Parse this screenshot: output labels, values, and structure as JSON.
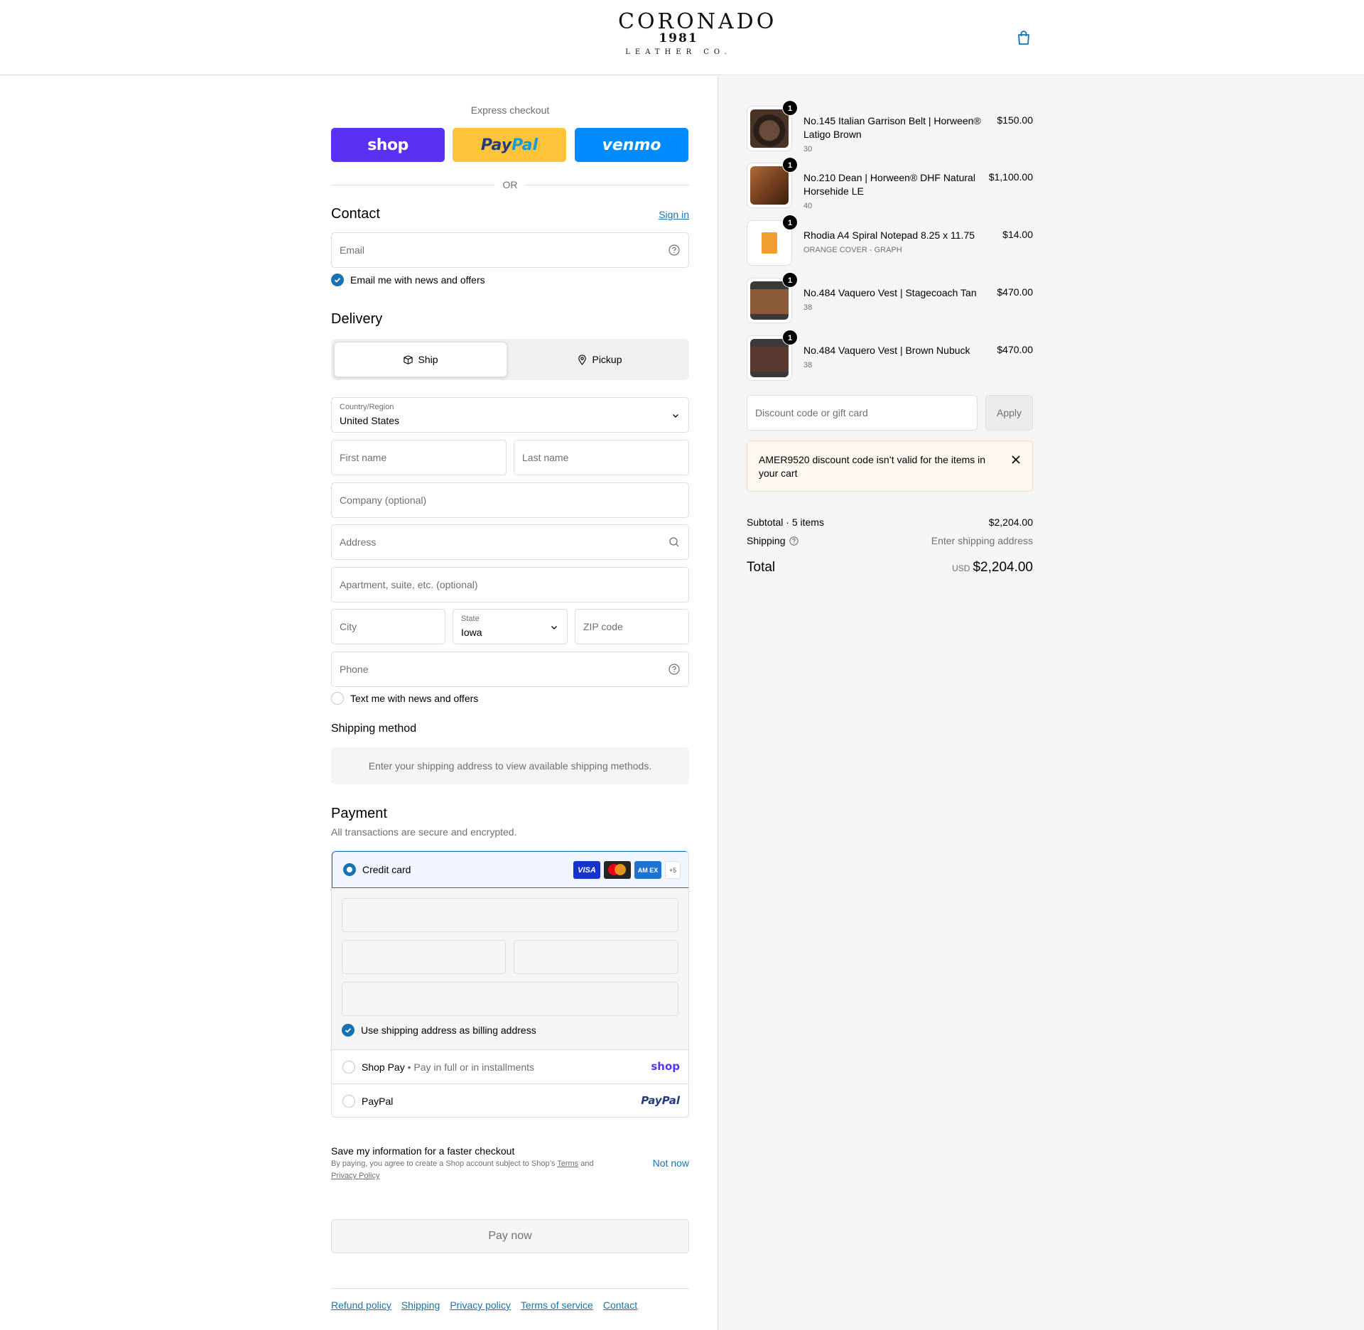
{
  "header": {
    "logo": {
      "word": "CORONADO",
      "year": "1981",
      "sub": "LEATHER CO."
    }
  },
  "express": {
    "title": "Express checkout",
    "shop_label": "shop",
    "paypal_label_1": "Pay",
    "paypal_label_2": "Pal",
    "venmo_label": "venmo",
    "or_label": "OR"
  },
  "contact": {
    "title": "Contact",
    "sign_in": "Sign in",
    "email_placeholder": "Email",
    "news_label": "Email me with news and offers"
  },
  "delivery": {
    "title": "Delivery",
    "ship_label": "Ship",
    "pickup_label": "Pickup",
    "country_label": "Country/Region",
    "country_value": "United States",
    "first_name": "First name",
    "last_name": "Last name",
    "company": "Company (optional)",
    "address": "Address",
    "apartment": "Apartment, suite, etc. (optional)",
    "city": "City",
    "state_label": "State",
    "state_value": "Iowa",
    "zip": "ZIP code",
    "phone": "Phone",
    "text_news": "Text me with news and offers"
  },
  "shipping_method": {
    "title": "Shipping method",
    "note": "Enter your shipping address to view available shipping methods."
  },
  "payment": {
    "title": "Payment",
    "subtitle": "All transactions are secure and encrypted.",
    "credit_card": "Credit card",
    "cards": {
      "visa": "VISA",
      "amex": "AM EX",
      "more": "+5"
    },
    "billing_same": "Use shipping address as billing address",
    "shop_pay": "Shop Pay",
    "shop_pay_sub": " • Pay in full or in installments",
    "shop_pay_brand": "shop",
    "paypal": "PayPal",
    "paypal_brand": "PayPal"
  },
  "save": {
    "title": "Save my information for a faster checkout",
    "text_1": "By paying, you agree to create a Shop account subject to Shop’s ",
    "terms": "Terms",
    "text_2": " and ",
    "privacy": "Privacy Policy",
    "not_now": "Not now"
  },
  "pay_now": "Pay now",
  "footer": {
    "links": [
      "Refund policy",
      "Shipping",
      "Privacy policy",
      "Terms of service",
      "Contact"
    ]
  },
  "order": {
    "items": [
      {
        "name": "No.145 Italian Garrison Belt | Horween® Latigo Brown",
        "variant": "30",
        "price": "$150.00",
        "qty": "1",
        "color": "#3a2a20"
      },
      {
        "name": "No.210 Dean | Horween® DHF Natural Horsehide LE",
        "variant": "40",
        "price": "$1,100.00",
        "qty": "1",
        "color": "#8a4a24"
      },
      {
        "name": "Rhodia A4 Spiral Notepad 8.25 x 11.75",
        "variant": "ORANGE COVER - GRAPH",
        "price": "$14.00",
        "qty": "1",
        "color": "#f0a030"
      },
      {
        "name": "No.484 Vaquero Vest | Stagecoach Tan",
        "variant": "38",
        "price": "$470.00",
        "qty": "1",
        "color": "#6a4028"
      },
      {
        "name": "No.484 Vaquero Vest | Brown Nubuck",
        "variant": "38",
        "price": "$470.00",
        "qty": "1",
        "color": "#4a3028"
      }
    ],
    "discount_placeholder": "Discount code or gift card",
    "apply": "Apply",
    "alert": "AMER9520 discount code isn’t valid for the items in your cart",
    "subtotal_label": "Subtotal · 5 items",
    "subtotal_value": "$2,204.00",
    "shipping_label": "Shipping",
    "shipping_value": "Enter shipping address",
    "total_label": "Total",
    "currency": "USD",
    "total_value": "$2,204.00"
  }
}
